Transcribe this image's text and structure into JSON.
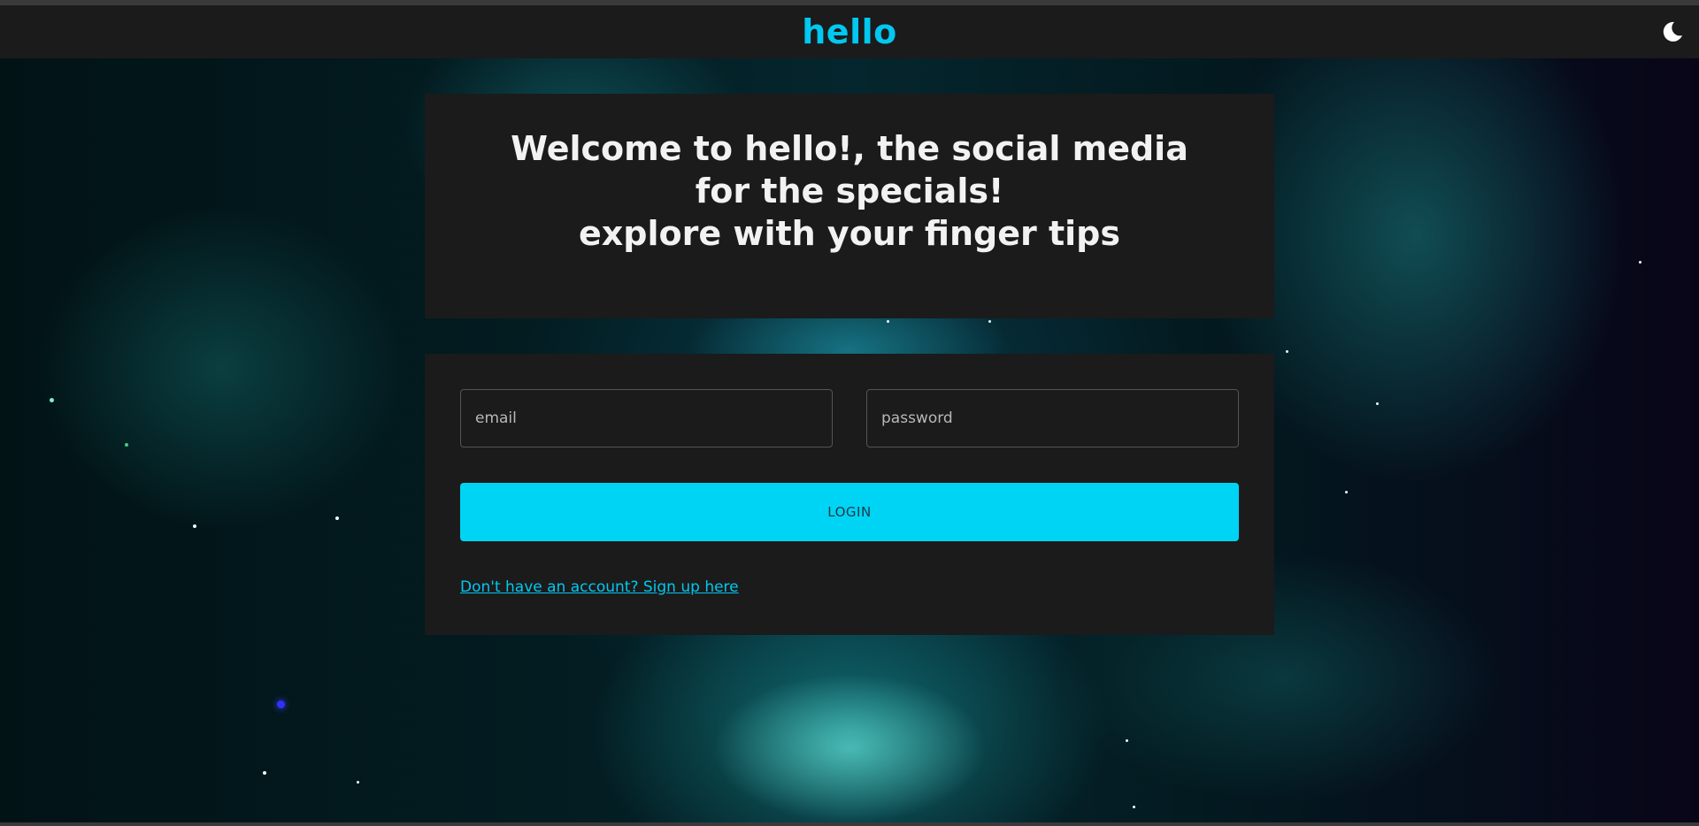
{
  "app": {
    "brand": "hello",
    "accent_color": "#00d4f5",
    "theme_toggle_icon": "moon-icon"
  },
  "welcome": {
    "line1": "Welcome to hello!, the social media for the specials!",
    "line2": "explore with your finger tips"
  },
  "login_form": {
    "email_placeholder": "email",
    "password_placeholder": "password",
    "login_label": "LOGIN",
    "signup_link": "Don't have an account? Sign up here"
  }
}
